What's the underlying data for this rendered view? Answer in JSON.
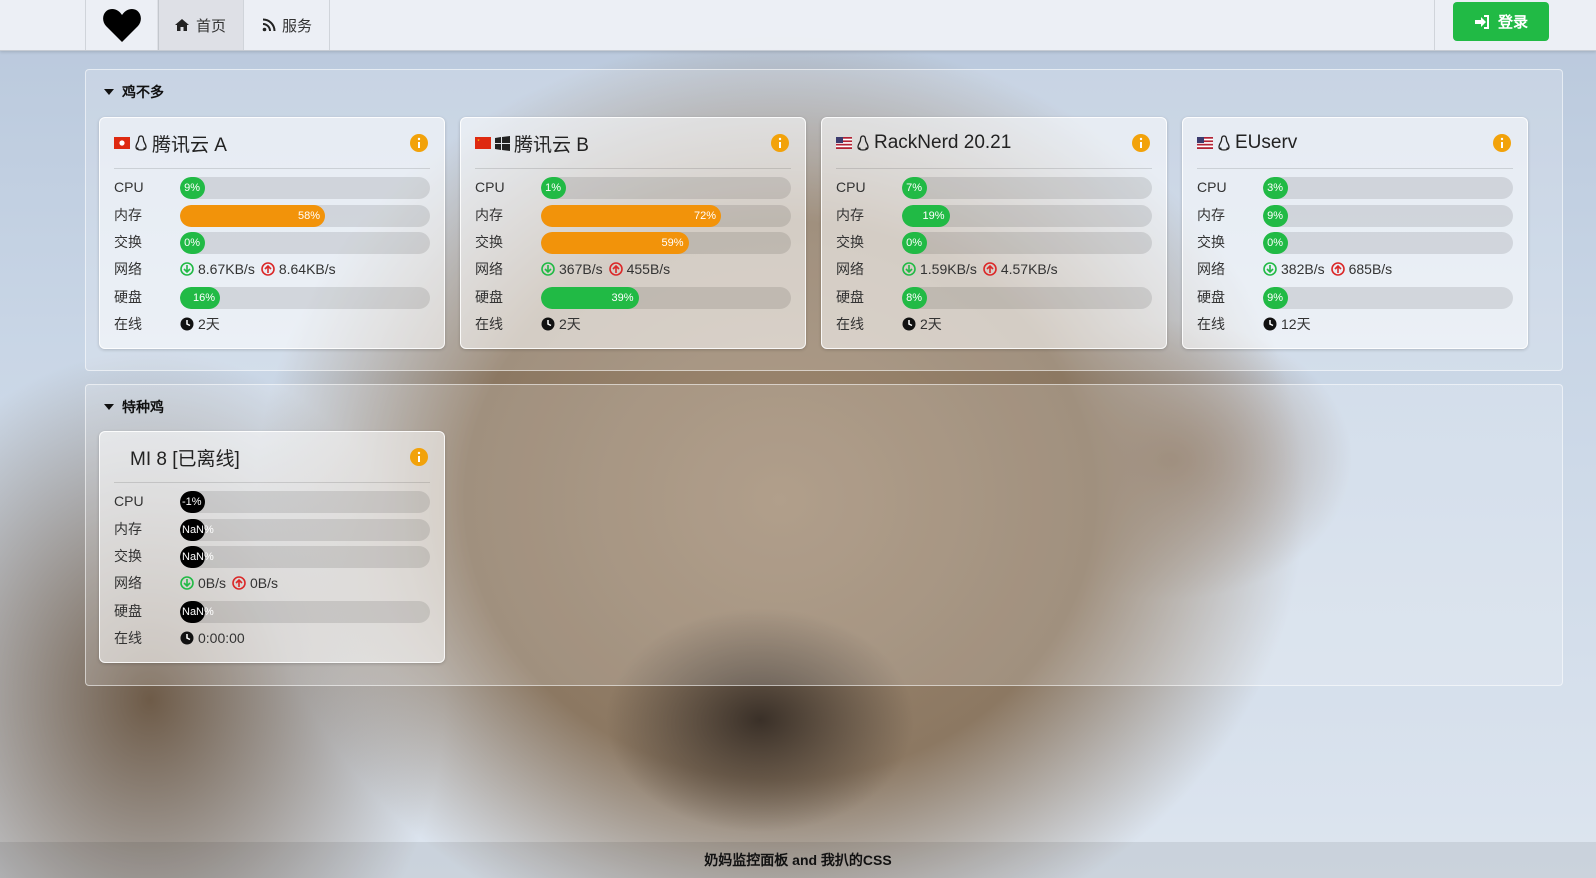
{
  "nav": {
    "logo_icon": "heart-icon",
    "home_label": "首页",
    "services_label": "服务",
    "login_label": "登录"
  },
  "groups": [
    {
      "title": "鸡不多",
      "servers": [
        {
          "name": "腾讯云 A",
          "flag": "HK",
          "os": "linux",
          "cpu": "9%",
          "cpu_value": 9,
          "mem": "58%",
          "mem_value": 58,
          "swap": "0%",
          "swap_value": 0,
          "net_down": "8.67KB/s",
          "net_up": "8.64KB/s",
          "disk": "16%",
          "disk_value": 16,
          "uptime": "2天"
        },
        {
          "name": "腾讯云 B",
          "flag": "CN",
          "os": "windows",
          "cpu": "1%",
          "cpu_value": 1,
          "mem": "72%",
          "mem_value": 72,
          "swap": "59%",
          "swap_value": 59,
          "net_down": "367B/s",
          "net_up": "455B/s",
          "disk": "39%",
          "disk_value": 39,
          "uptime": "2天"
        },
        {
          "name": "RackNerd 20.21",
          "flag": "US",
          "os": "linux",
          "cpu": "7%",
          "cpu_value": 7,
          "mem": "19%",
          "mem_value": 19,
          "swap": "0%",
          "swap_value": 0,
          "net_down": "1.59KB/s",
          "net_up": "4.57KB/s",
          "disk": "8%",
          "disk_value": 8,
          "uptime": "2天"
        },
        {
          "name": "EUserv",
          "flag": "US",
          "os": "linux",
          "cpu": "3%",
          "cpu_value": 3,
          "mem": "9%",
          "mem_value": 9,
          "swap": "0%",
          "swap_value": 0,
          "net_down": "382B/s",
          "net_up": "685B/s",
          "disk": "9%",
          "disk_value": 9,
          "uptime": "12天"
        }
      ]
    },
    {
      "title": "特种鸡",
      "servers": [
        {
          "name": "MI 8 [已离线]",
          "cpu": "-1%",
          "cpu_value": -1,
          "mem": "NaN%",
          "swap": "NaN%",
          "net_down": "0B/s",
          "net_up": "0B/s",
          "disk": "NaN%",
          "uptime": "0:00:00"
        }
      ]
    }
  ],
  "labels": {
    "cpu": "CPU",
    "mem": "内存",
    "swap": "交换",
    "net": "网络",
    "disk": "硬盘",
    "uptime": "在线"
  },
  "footer": "奶妈监控面板 and 我扒的CSS",
  "colors": {
    "green": "#21ba45",
    "orange": "#f2930a",
    "info": "#f2a20a",
    "down": "#21ba45",
    "up": "#db2828"
  }
}
